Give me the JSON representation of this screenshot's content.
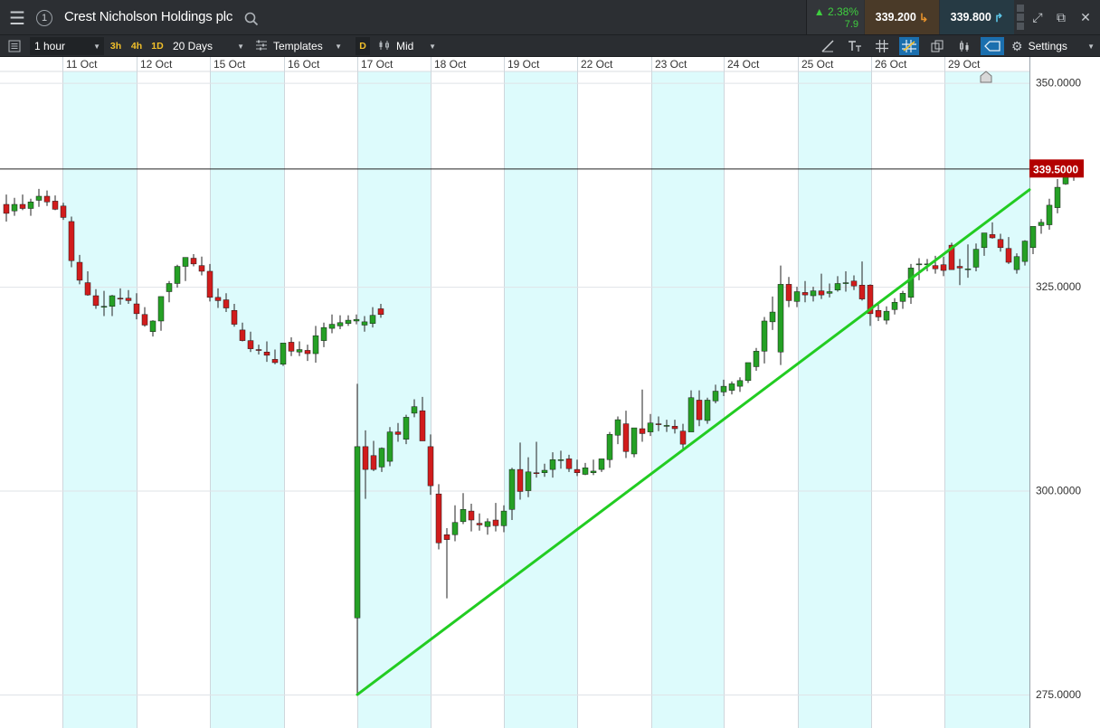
{
  "header": {
    "tab_number": "1",
    "instrument": "Crest Nicholson Holdings plc",
    "change_pct": "▲ 2.38%",
    "change_pts": "7.9",
    "sell_price": "339.200",
    "buy_price": "339.800",
    "colors": {
      "positive": "#3fcf3f",
      "sell": "#e8932c",
      "buy": "#5cc6e8"
    }
  },
  "toolbar": {
    "interval": "1 hour",
    "quick_intervals": [
      "3h",
      "4h",
      "1D"
    ],
    "range": "20 Days",
    "templates_label": "Templates",
    "d_label": "D",
    "price_type": "Mid",
    "settings_label": "Settings",
    "icons": [
      "draw-line-icon",
      "text-tool-icon",
      "crosshair-icon",
      "grid-icon",
      "copy-chart-icon",
      "candle-type-icon",
      "tag-icon",
      "gear-icon"
    ]
  },
  "chart_data": {
    "type": "candlestick",
    "x_labels": [
      "11 Oct",
      "12 Oct",
      "15 Oct",
      "16 Oct",
      "17 Oct",
      "18 Oct",
      "19 Oct",
      "22 Oct",
      "23 Oct",
      "24 Oct",
      "25 Oct",
      "26 Oct",
      "29 Oct"
    ],
    "y_ticks": [
      "350.0000",
      "325.0000",
      "300.0000",
      "275.0000"
    ],
    "y_tick_values": [
      350,
      325,
      300,
      275
    ],
    "ylim": [
      270.9,
      351.4
    ],
    "current_price_label": "339.5000",
    "current_price": 339.5,
    "grid": true,
    "colors": {
      "up": "#25a025",
      "down": "#d11c1c",
      "trendline": "#22cc22",
      "price_tag": "#b30000",
      "band": "#ddfbfc"
    },
    "trendline": {
      "from": {
        "day": "17 Oct",
        "price": 275.0
      },
      "to": {
        "day": "29 Oct",
        "price": 336.0
      }
    },
    "candles": [
      [
        335.1,
        336.3,
        333.0,
        334.0
      ],
      [
        334.3,
        335.9,
        333.7,
        335.1
      ],
      [
        335.1,
        336.3,
        334.4,
        334.6
      ],
      [
        334.6,
        335.8,
        333.7,
        335.4
      ],
      [
        335.6,
        337.0,
        334.8,
        336.1
      ],
      [
        336.1,
        336.8,
        334.9,
        335.4
      ],
      [
        335.5,
        336.2,
        334.4,
        334.5
      ],
      [
        334.9,
        335.3,
        333.2,
        333.5
      ],
      [
        333.0,
        333.6,
        327.4,
        328.2
      ],
      [
        328.0,
        328.9,
        325.3,
        325.8
      ],
      [
        325.5,
        326.9,
        323.9,
        324.0
      ],
      [
        323.9,
        324.7,
        322.3,
        322.7
      ],
      [
        322.5,
        324.5,
        321.4,
        322.6
      ],
      [
        322.6,
        324.0,
        321.4,
        323.9
      ],
      [
        323.6,
        324.8,
        322.8,
        323.5
      ],
      [
        323.6,
        324.6,
        322.9,
        323.3
      ],
      [
        322.9,
        324.2,
        321.0,
        321.7
      ],
      [
        321.6,
        322.5,
        320.1,
        320.3
      ],
      [
        319.5,
        320.9,
        318.9,
        320.8
      ],
      [
        320.8,
        323.8,
        319.6,
        323.8
      ],
      [
        324.4,
        325.7,
        323.1,
        325.4
      ],
      [
        325.4,
        327.7,
        324.9,
        327.5
      ],
      [
        327.5,
        328.6,
        325.7,
        328.6
      ],
      [
        328.5,
        329.0,
        327.5,
        327.8
      ],
      [
        327.6,
        328.7,
        326.4,
        326.9
      ],
      [
        326.9,
        327.8,
        323.2,
        323.7
      ],
      [
        323.7,
        324.8,
        322.4,
        323.3
      ],
      [
        323.4,
        324.2,
        321.9,
        322.4
      ],
      [
        322.1,
        322.9,
        320.1,
        320.4
      ],
      [
        319.7,
        320.6,
        318.3,
        318.4
      ],
      [
        318.4,
        319.5,
        317.0,
        317.4
      ],
      [
        317.3,
        317.9,
        316.7,
        317.2
      ],
      [
        317.0,
        318.3,
        315.8,
        316.6
      ],
      [
        316.1,
        317.3,
        315.5,
        315.7
      ],
      [
        315.5,
        318.1,
        315.3,
        318.1
      ],
      [
        318.2,
        318.8,
        316.5,
        317.1
      ],
      [
        317.0,
        318.3,
        316.5,
        317.3
      ],
      [
        317.2,
        317.9,
        315.9,
        316.8
      ],
      [
        316.8,
        320.2,
        315.7,
        319.0
      ],
      [
        318.4,
        320.6,
        317.6,
        320.0
      ],
      [
        319.9,
        321.6,
        319.3,
        320.4
      ],
      [
        320.2,
        321.5,
        319.8,
        320.6
      ],
      [
        320.5,
        321.5,
        320.2,
        320.9
      ],
      [
        320.8,
        321.6,
        320.4,
        321.0
      ],
      [
        320.3,
        321.4,
        319.5,
        320.7
      ],
      [
        320.5,
        322.5,
        320.0,
        321.5
      ],
      [
        322.3,
        322.9,
        321.2,
        321.6
      ],
      [
        284.4,
        313.1,
        275.0,
        305.4
      ],
      [
        305.4,
        307.4,
        299.0,
        302.6
      ],
      [
        304.3,
        306.1,
        302.4,
        302.6
      ],
      [
        302.9,
        305.3,
        302.3,
        305.2
      ],
      [
        303.6,
        307.8,
        303.0,
        307.2
      ],
      [
        307.2,
        308.3,
        306.0,
        306.9
      ],
      [
        306.3,
        309.3,
        305.7,
        309.0
      ],
      [
        309.5,
        311.2,
        309.0,
        310.3
      ],
      [
        309.8,
        311.5,
        306.2,
        306.1
      ],
      [
        305.4,
        306.9,
        299.5,
        300.6
      ],
      [
        299.6,
        300.8,
        292.8,
        293.6
      ],
      [
        294.6,
        295.4,
        286.8,
        294.0
      ],
      [
        294.6,
        298.2,
        293.8,
        296.1
      ],
      [
        296.2,
        299.7,
        295.9,
        297.7
      ],
      [
        297.5,
        298.4,
        295.0,
        296.4
      ],
      [
        296.0,
        297.2,
        295.1,
        295.8
      ],
      [
        295.6,
        296.6,
        294.6,
        296.2
      ],
      [
        296.4,
        298.5,
        295.0,
        295.7
      ],
      [
        295.7,
        298.2,
        294.9,
        297.5
      ],
      [
        297.7,
        302.8,
        296.4,
        302.6
      ],
      [
        302.6,
        305.9,
        298.9,
        299.9
      ],
      [
        300.0,
        304.1,
        299.2,
        302.3
      ],
      [
        302.2,
        306.0,
        301.6,
        302.1
      ],
      [
        302.2,
        303.3,
        301.7,
        302.5
      ],
      [
        302.6,
        304.7,
        301.6,
        303.8
      ],
      [
        303.8,
        304.9,
        302.7,
        303.8
      ],
      [
        303.9,
        304.4,
        302.3,
        302.7
      ],
      [
        302.6,
        303.8,
        301.8,
        302.2
      ],
      [
        302.0,
        303.4,
        301.9,
        302.8
      ],
      [
        302.2,
        303.8,
        301.9,
        302.4
      ],
      [
        302.6,
        303.9,
        302.3,
        303.9
      ],
      [
        303.8,
        307.2,
        302.8,
        306.9
      ],
      [
        306.8,
        309.1,
        305.7,
        308.7
      ],
      [
        308.2,
        309.8,
        304.0,
        304.8
      ],
      [
        304.5,
        307.0,
        304.1,
        307.7
      ],
      [
        307.6,
        312.4,
        306.0,
        307.0
      ],
      [
        307.2,
        309.4,
        306.7,
        308.3
      ],
      [
        308.2,
        309.1,
        307.3,
        308.1
      ],
      [
        308.0,
        308.7,
        307.2,
        308.0
      ],
      [
        307.9,
        308.7,
        307.0,
        307.6
      ],
      [
        307.3,
        308.2,
        305.1,
        305.7
      ],
      [
        307.2,
        312.3,
        307.6,
        311.4
      ],
      [
        311.1,
        312.3,
        307.9,
        308.7
      ],
      [
        308.6,
        311.4,
        308.2,
        311.1
      ],
      [
        311.0,
        313.0,
        310.7,
        312.2
      ],
      [
        312.1,
        313.6,
        311.6,
        312.8
      ],
      [
        312.3,
        313.4,
        311.8,
        313.1
      ],
      [
        312.8,
        313.9,
        312.1,
        313.5
      ],
      [
        313.5,
        315.6,
        313.2,
        315.7
      ],
      [
        315.2,
        317.5,
        314.7,
        317.1
      ],
      [
        317.1,
        321.3,
        315.6,
        320.8
      ],
      [
        320.7,
        323.8,
        319.7,
        321.9
      ],
      [
        317.0,
        327.6,
        315.4,
        325.3
      ],
      [
        325.3,
        326.2,
        322.5,
        323.3
      ],
      [
        323.2,
        325.0,
        322.5,
        324.4
      ],
      [
        324.3,
        325.7,
        323.1,
        324.0
      ],
      [
        323.9,
        325.0,
        323.2,
        324.5
      ],
      [
        324.5,
        326.6,
        323.5,
        324.0
      ],
      [
        324.2,
        325.4,
        323.7,
        324.4
      ],
      [
        324.6,
        326.3,
        324.4,
        325.4
      ],
      [
        325.5,
        326.9,
        324.4,
        325.5
      ],
      [
        325.7,
        326.4,
        324.6,
        325.1
      ],
      [
        325.2,
        328.1,
        323.3,
        323.5
      ],
      [
        325.2,
        325.3,
        320.2,
        321.7
      ],
      [
        322.1,
        322.9,
        320.8,
        321.3
      ],
      [
        320.9,
        322.6,
        320.4,
        322.0
      ],
      [
        322.2,
        323.6,
        321.6,
        323.1
      ],
      [
        323.2,
        324.5,
        322.3,
        324.2
      ],
      [
        323.7,
        327.8,
        322.9,
        327.3
      ],
      [
        327.7,
        328.5,
        325.8,
        327.8
      ],
      [
        327.8,
        328.4,
        326.9,
        327.8
      ],
      [
        327.6,
        328.8,
        326.6,
        327.2
      ],
      [
        327.7,
        328.7,
        326.3,
        327.0
      ],
      [
        330.1,
        330.4,
        327.7,
        327.1
      ],
      [
        327.5,
        328.4,
        325.2,
        327.3
      ],
      [
        327.2,
        330.2,
        326.1,
        327.2
      ],
      [
        327.4,
        330.3,
        326.9,
        329.6
      ],
      [
        329.8,
        331.6,
        328.8,
        331.6
      ],
      [
        331.4,
        332.9,
        330.9,
        331.0
      ],
      [
        330.8,
        331.5,
        329.3,
        329.8
      ],
      [
        329.7,
        331.1,
        327.8,
        328.0
      ],
      [
        327.1,
        329.1,
        326.6,
        328.7
      ],
      [
        328.1,
        330.7,
        327.6,
        330.6
      ],
      [
        329.8,
        332.1,
        329.0,
        332.4
      ],
      [
        332.5,
        333.3,
        331.5,
        332.9
      ],
      [
        332.6,
        335.8,
        332.0,
        335.0
      ],
      [
        334.7,
        338.2,
        334.0,
        337.2
      ],
      [
        337.6,
        339.5,
        337.5,
        338.8
      ],
      [
        338.6,
        339.4,
        338.0,
        339.1
      ]
    ]
  }
}
